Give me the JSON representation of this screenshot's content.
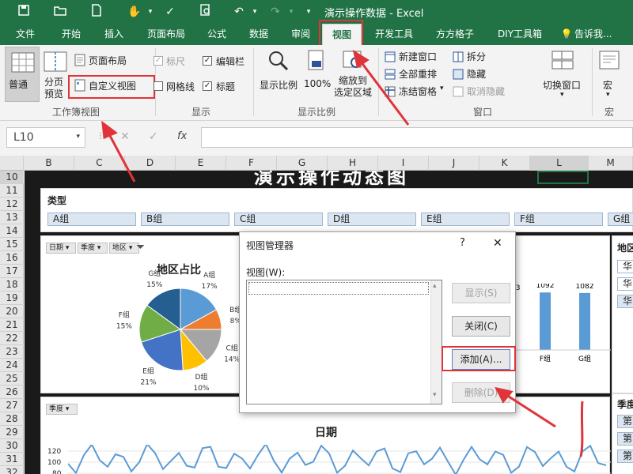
{
  "window": {
    "title": "演示操作数据 - Excel"
  },
  "tabs": [
    {
      "label": "文件"
    },
    {
      "label": "开始"
    },
    {
      "label": "插入"
    },
    {
      "label": "页面布局"
    },
    {
      "label": "公式"
    },
    {
      "label": "数据"
    },
    {
      "label": "审阅"
    },
    {
      "label": "视图",
      "active": true
    },
    {
      "label": "开发工具"
    },
    {
      "label": "方方格子"
    },
    {
      "label": "DIY工具箱"
    }
  ],
  "tell_me": "告诉我...",
  "ribbon": {
    "workbook_views": {
      "group_label": "工作簿视图",
      "normal": "普通",
      "page_break": "分页\n预览",
      "page_layout": "页面布局",
      "custom_views": "自定义视图"
    },
    "show": {
      "group_label": "显示",
      "ruler": "标尺",
      "formula_bar": "编辑栏",
      "gridlines": "网格线",
      "headings": "标题"
    },
    "zoom": {
      "group_label": "显示比例",
      "zoom": "显示比例",
      "zoom_100": "100%",
      "zoom_to_selection": "缩放到\n选定区域"
    },
    "window": {
      "group_label": "窗口",
      "new_window": "新建窗口",
      "arrange_all": "全部重排",
      "freeze_panes": "冻结窗格",
      "split": "拆分",
      "hide": "隐藏",
      "unhide": "取消隐藏",
      "switch_windows": "切换窗口"
    },
    "macros": {
      "group_label": "宏",
      "macros": "宏"
    }
  },
  "name_box": "L10",
  "fx": "fx",
  "columns": [
    "B",
    "C",
    "D",
    "E",
    "F",
    "G",
    "H",
    "I",
    "J",
    "K",
    "L",
    "M"
  ],
  "rows": [
    "10",
    "11",
    "12",
    "13",
    "14",
    "15",
    "16",
    "17",
    "18",
    "19",
    "20",
    "21",
    "22",
    "23",
    "24",
    "25",
    "26",
    "27",
    "28",
    "29",
    "30",
    "31",
    "32"
  ],
  "sheet": {
    "header_title": "演示操作动态图",
    "type_label": "类型",
    "type_buttons": [
      "A组",
      "B组",
      "C组",
      "D组",
      "E组",
      "F组",
      "G组"
    ],
    "filter_buttons": [
      "日期",
      "季度",
      "地区"
    ],
    "right_slicer_top": "地区",
    "right_slicer_top_items": [
      "华",
      "华",
      "华"
    ],
    "right_slicer_bottom": "季度",
    "right_slicer_bottom_items": [
      "第",
      "第",
      "第"
    ],
    "line_filter": "季度"
  },
  "pie_chart": {
    "title": "地区占比",
    "slices": [
      {
        "label": "A组",
        "pct": "17%",
        "value": 17,
        "color": "#5b9bd5"
      },
      {
        "label": "B组",
        "pct": "8%",
        "value": 8,
        "color": "#ed7d31"
      },
      {
        "label": "C组",
        "pct": "14%",
        "value": 14,
        "color": "#a5a5a5"
      },
      {
        "label": "D组",
        "pct": "10%",
        "value": 10,
        "color": "#ffc000"
      },
      {
        "label": "E组",
        "pct": "21%",
        "value": 21,
        "color": "#4472c4"
      },
      {
        "label": "F组",
        "pct": "15%",
        "value": 15,
        "color": "#70ad47"
      },
      {
        "label": "G组",
        "pct": "15%",
        "value": 15,
        "color": "#255e91"
      }
    ]
  },
  "bar_chart": {
    "partial_label": "03",
    "bars": [
      {
        "label": "F组",
        "value": 1092
      },
      {
        "label": "G组",
        "value": 1082
      }
    ],
    "color": "#5b9bd5"
  },
  "line_chart": {
    "title": "日期",
    "y_ticks": [
      "120",
      "100",
      "80"
    ],
    "color": "#5b9bd5"
  },
  "dialog": {
    "title": "视图管理器",
    "help": "?",
    "close": "✕",
    "list_label": "视图(W):",
    "show_btn": "显示(S)",
    "close_btn": "关闭(C)",
    "add_btn": "添加(A)...",
    "delete_btn": "删除(D)"
  },
  "colors": {
    "excel_green": "#217346",
    "highlight_red": "#e0343a"
  }
}
